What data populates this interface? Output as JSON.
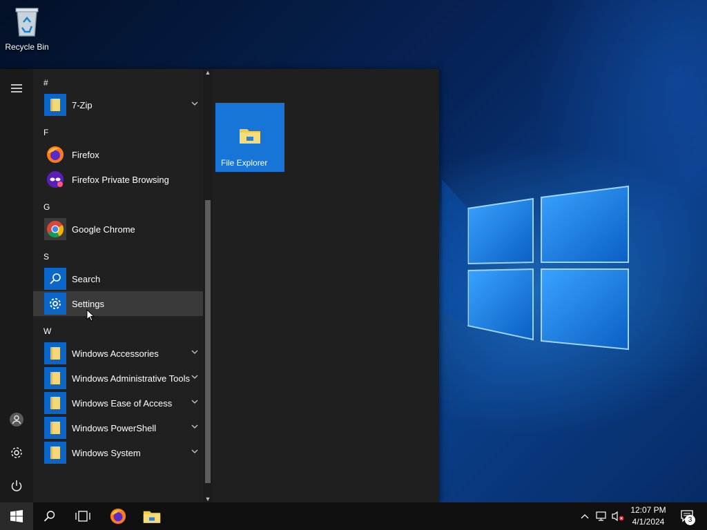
{
  "desktop": {
    "recycle_bin_label": "Recycle Bin"
  },
  "start_menu": {
    "groups": [
      {
        "header": "#",
        "apps": [
          {
            "name": "7-Zip",
            "icon": "folder-icon",
            "expandable": true
          }
        ]
      },
      {
        "header": "F",
        "apps": [
          {
            "name": "Firefox",
            "icon": "firefox-icon",
            "expandable": false
          },
          {
            "name": "Firefox Private Browsing",
            "icon": "firefox-private-icon",
            "expandable": false
          }
        ]
      },
      {
        "header": "G",
        "apps": [
          {
            "name": "Google Chrome",
            "icon": "chrome-icon",
            "expandable": false
          }
        ]
      },
      {
        "header": "S",
        "apps": [
          {
            "name": "Search",
            "icon": "search-icon",
            "expandable": false
          },
          {
            "name": "Settings",
            "icon": "gear-icon",
            "expandable": false
          }
        ]
      },
      {
        "header": "W",
        "apps": [
          {
            "name": "Windows Accessories",
            "icon": "folder-icon",
            "expandable": true
          },
          {
            "name": "Windows Administrative Tools",
            "icon": "folder-icon",
            "expandable": true
          },
          {
            "name": "Windows Ease of Access",
            "icon": "folder-icon",
            "expandable": true
          },
          {
            "name": "Windows PowerShell",
            "icon": "folder-icon",
            "expandable": true
          },
          {
            "name": "Windows System",
            "icon": "folder-icon",
            "expandable": true
          }
        ]
      }
    ],
    "tiles": [
      {
        "name": "File Explorer",
        "icon": "file-explorer-icon"
      }
    ]
  },
  "taskbar": {
    "clock_time": "12:07 PM",
    "clock_date": "4/1/2024",
    "notification_count": "3"
  },
  "colors": {
    "accent": "#0a66c8",
    "tile": "#1675d6",
    "taskbar": "#101010"
  }
}
